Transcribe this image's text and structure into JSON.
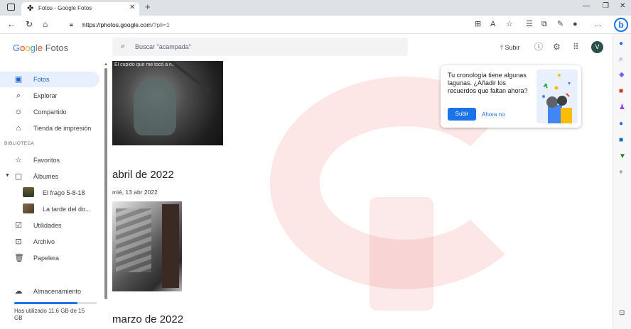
{
  "browser": {
    "tab_title": "Fotos - Google Fotos",
    "url_host": "https://photos.google.com",
    "url_path": "/?pli=1"
  },
  "app": {
    "logo_g1": "G",
    "logo_g2": "o",
    "logo_g3": "o",
    "logo_g4": "g",
    "logo_g5": "l",
    "logo_g6": "e",
    "logo_product": "Fotos",
    "search_placeholder": "Buscar \"acampada\"",
    "upload_label": "Subir",
    "avatar_letter": "V"
  },
  "nav": {
    "fotos": "Fotos",
    "explorar": "Explorar",
    "compartido": "Compartido",
    "tienda": "Tienda de impresión",
    "biblioteca": "BIBLIOTECA",
    "favoritos": "Favoritos",
    "albumes": "Álbumes",
    "album1": "El frago 5-8-18",
    "album2": "La tarde del do...",
    "utilidades": "Utilidades",
    "archivo": "Archivo",
    "papelera": "Papelera",
    "almacenamiento": "Almacenamiento",
    "storage_used": "Has utilizado 11,6 GB de 15 GB",
    "storage_fraction": 0.77
  },
  "content": {
    "photo1_caption": "El cupido que me tocó a mí.",
    "section_april": "abril de 2022",
    "day_april": "mié, 13 abr 2022",
    "section_march": "marzo de 2022"
  },
  "popup": {
    "text": "Tu cronología tiene algunas lagunas. ¿Añadir los recuerdos que faltan ahora?",
    "primary": "Subir",
    "secondary": "Ahora no"
  }
}
